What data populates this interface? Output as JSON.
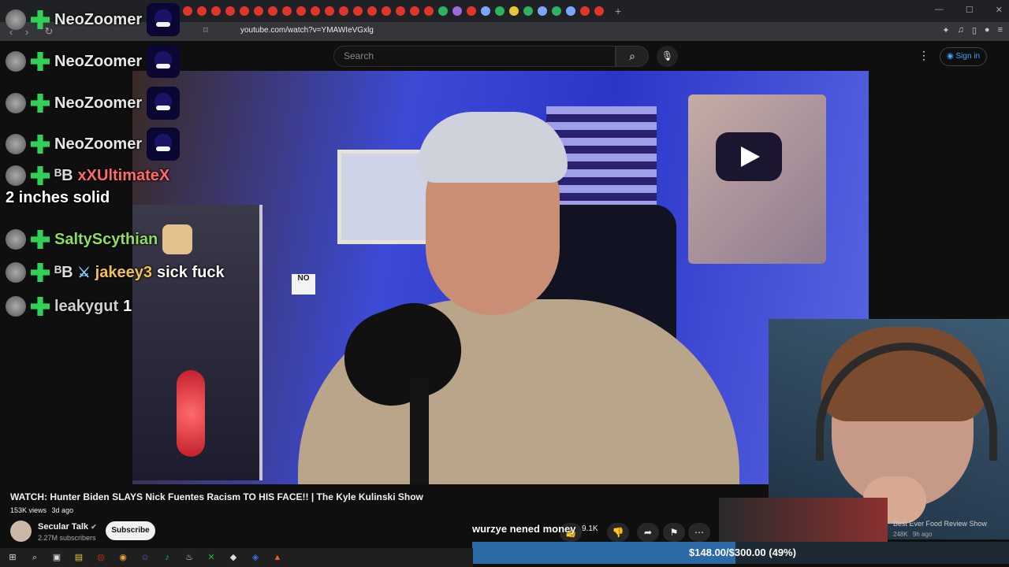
{
  "browser": {
    "url": "youtube.com/watch?v=YMAWIeVGxlg",
    "tab_favicon_colors": [
      "#e0352b",
      "#e0352b",
      "#e0352b",
      "#e0352b",
      "#e0352b",
      "#e0352b",
      "#e0352b",
      "#e0352b",
      "#e0352b",
      "#e0352b",
      "#e0352b",
      "#e0352b",
      "#e0352b",
      "#e0352b",
      "#e0352b",
      "#e0352b",
      "#e0352b",
      "#e0352b",
      "#2fb15f",
      "#9d6ad9",
      "#e0352b",
      "#7aa6ff",
      "#2fb15f",
      "#e6c53b",
      "#2fb15f",
      "#7aa6ff",
      "#2fb15f",
      "#7aa6ff",
      "#e0352b",
      "#e0352b"
    ],
    "new_tab_icon": "plus-icon"
  },
  "youtube": {
    "search_placeholder": "Search",
    "sign_in_label": "Sign in",
    "video_title": "WATCH: Hunter Biden SLAYS Nick Fuentes Racism TO HIS FACE!! | The Kyle Kulinski Show",
    "views": "153K views",
    "age": "3d ago",
    "channel_name": "Secular Talk",
    "channel_subs": "2.27M subscribers",
    "subscribe_label": "Subscribe",
    "likes": "9.1K",
    "recommended": {
      "title": "Best Ever Food Review Show",
      "views": "248K",
      "age": "9h ago"
    },
    "video_sign": "NO"
  },
  "chat": [
    {
      "user": "NeoZoomer",
      "text": "",
      "user_color": "#e6e6e6",
      "badges": [
        "mod"
      ],
      "emote": true
    },
    {
      "user": "NeoZoomer",
      "text": "",
      "user_color": "#e6e6e6",
      "badges": [
        "mod"
      ],
      "emote": true
    },
    {
      "user": "NeoZoomer",
      "text": "",
      "user_color": "#e6e6e6",
      "badges": [
        "mod"
      ],
      "emote": true
    },
    {
      "user": "NeoZoomer",
      "text": "",
      "user_color": "#e6e6e6",
      "badges": [
        "mod"
      ],
      "emote": true
    },
    {
      "user": "xXUltimateX",
      "text": "2 inches solid",
      "user_color": "#ff6b6b",
      "badges": [
        "mod",
        "B"
      ]
    },
    {
      "user": "SaltyScythian",
      "text": "",
      "user_color": "#8fdc5e",
      "badges": [
        "mod"
      ],
      "emote2": true
    },
    {
      "user": "jakeey3",
      "text": "sick fuck",
      "user_color": "#f2c14e",
      "badges": [
        "mod",
        "B",
        "sword"
      ]
    },
    {
      "user": "leakygut",
      "text": "1",
      "user_color": "#d0d0d0",
      "badges": [
        "mod"
      ]
    }
  ],
  "overlay": {
    "message": "wurzye nened money",
    "donation_text": "$148.00/$300.00 (49%)",
    "donation_progress": 0.49
  },
  "taskbar_icons": [
    "windows-icon",
    "search-icon",
    "task-view-icon",
    "file-explorer-icon",
    "opera-icon",
    "chrome-icon",
    "discord-icon",
    "spotify-icon",
    "steam-icon",
    "xbox-icon",
    "app-icon",
    "ea-icon",
    "brave-icon"
  ]
}
